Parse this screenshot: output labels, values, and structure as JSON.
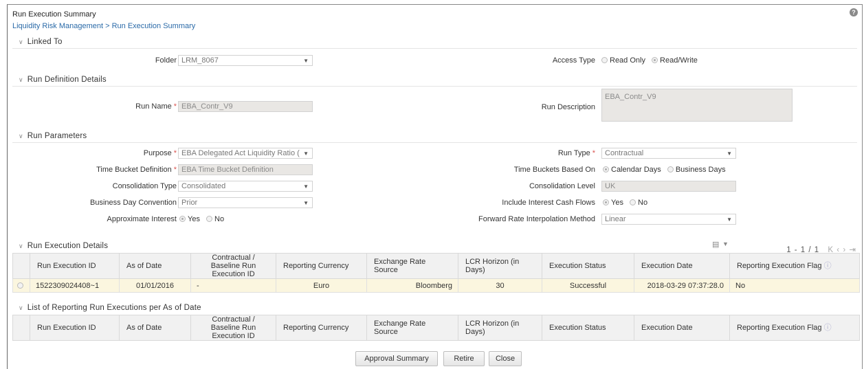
{
  "page": {
    "title": "Run Execution Summary",
    "breadcrumb": "Liquidity Risk Management > Run Execution Summary"
  },
  "linked_to": {
    "header": "Linked To",
    "folder_label": "Folder",
    "folder_value": "LRM_8067",
    "access_type_label": "Access Type",
    "access_options": [
      "Read Only",
      "Read/Write"
    ],
    "access_selected": "Read/Write"
  },
  "run_definition": {
    "header": "Run Definition Details",
    "run_name_label": "Run Name",
    "run_name_value": "EBA_Contr_V9",
    "run_description_label": "Run Description",
    "run_description_value": "EBA_Contr_V9"
  },
  "run_parameters": {
    "header": "Run Parameters",
    "purpose_label": "Purpose",
    "purpose_value": "EBA Delegated Act Liquidity Ratio (",
    "time_bucket_label": "Time Bucket Definition",
    "time_bucket_value": "EBA Time Bucket Definition",
    "consolidation_type_label": "Consolidation Type",
    "consolidation_type_value": "Consolidated",
    "bdc_label": "Business Day Convention",
    "bdc_value": "Prior",
    "approx_interest_label": "Approximate Interest",
    "approx_interest_options": [
      "Yes",
      "No"
    ],
    "run_type_label": "Run Type",
    "run_type_value": "Contractual",
    "tb_based_on_label": "Time Buckets Based On",
    "tb_based_on_options": [
      "Calendar Days",
      "Business Days"
    ],
    "consolidation_level_label": "Consolidation Level",
    "consolidation_level_value": "UK",
    "include_interest_label": "Include Interest Cash Flows",
    "include_interest_options": [
      "Yes",
      "No"
    ],
    "fwd_rate_label": "Forward Rate Interpolation Method",
    "fwd_rate_value": "Linear"
  },
  "run_execution": {
    "header": "Run Execution Details",
    "pager": "1 - 1 / 1",
    "columns": [
      "Run Execution ID",
      "As of Date",
      "Contractual / Baseline Run Execution ID",
      "Reporting Currency",
      "Exchange Rate Source",
      "LCR Horizon (in Days)",
      "Execution Status",
      "Execution Date",
      "Reporting Execution Flag"
    ],
    "rows": [
      [
        "1522309024408~1",
        "01/01/2016",
        "-",
        "Euro",
        "Bloomberg",
        "30",
        "Successful",
        "2018-03-29 07:37:28.0",
        "No"
      ]
    ]
  },
  "reporting_runs": {
    "header": "List of Reporting Run Executions per As of Date",
    "columns": [
      "Run Execution ID",
      "As of Date",
      "Contractual / Baseline Run Execution ID",
      "Reporting Currency",
      "Exchange Rate Source",
      "LCR Horizon (in Days)",
      "Execution Status",
      "Execution Date",
      "Reporting Execution Flag"
    ]
  },
  "buttons": {
    "approval_summary": "Approval Summary",
    "retire": "Retire",
    "close": "Close"
  },
  "colors": {
    "breadcrumb": "#2a6aa8",
    "required": "#d9534f",
    "selected_row": "#fbf6df"
  },
  "icons": {
    "help": "help-icon",
    "export": "export-icon",
    "filter": "filter-icon",
    "first": "first-page-icon",
    "prev": "prev-page-icon",
    "next": "next-page-icon",
    "last": "last-page-icon"
  }
}
